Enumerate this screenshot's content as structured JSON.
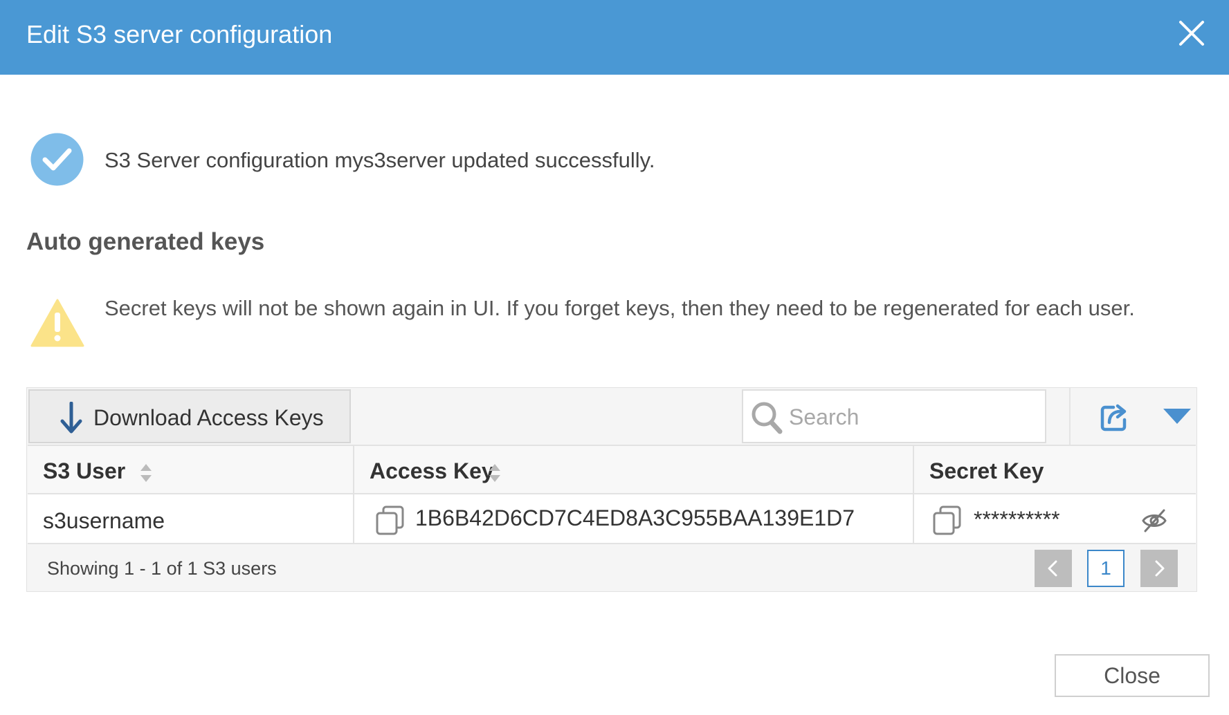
{
  "dialog": {
    "title": "Edit S3 server configuration"
  },
  "success": {
    "message": "S3 Server configuration mys3server updated successfully."
  },
  "section": {
    "title": "Auto generated keys"
  },
  "warning": {
    "message": "Secret keys will not be shown again in UI. If you forget keys, then they need to be regenerated for each user."
  },
  "toolbar": {
    "download_label": "Download Access Keys",
    "search_placeholder": "Search"
  },
  "table": {
    "columns": [
      {
        "label": "S3 User",
        "sortable": true
      },
      {
        "label": "Access Key",
        "sortable": true
      },
      {
        "label": "Secret Key",
        "sortable": false
      }
    ],
    "rows": [
      {
        "s3_user": "s3username",
        "access_key": "1B6B42D6CD7C4ED8A3C955BAA139E1D7",
        "secret_key": "**********"
      }
    ]
  },
  "footer": {
    "status": "Showing 1 - 1 of 1 S3 users",
    "current_page": "1"
  },
  "actions": {
    "close_label": "Close"
  },
  "colors": {
    "header_bg": "#4a98d4",
    "success_icon": "#7fbde9",
    "warning_icon": "#fbe389",
    "accent": "#3b87c9"
  },
  "icons": {
    "close": "close-icon",
    "success": "checkmark-circle-icon",
    "warning": "warning-triangle-icon",
    "download": "download-arrow-icon",
    "search": "search-icon",
    "export": "export-icon",
    "sort": "sort-icon",
    "copy": "copy-icon",
    "reveal": "eye-slash-icon"
  }
}
